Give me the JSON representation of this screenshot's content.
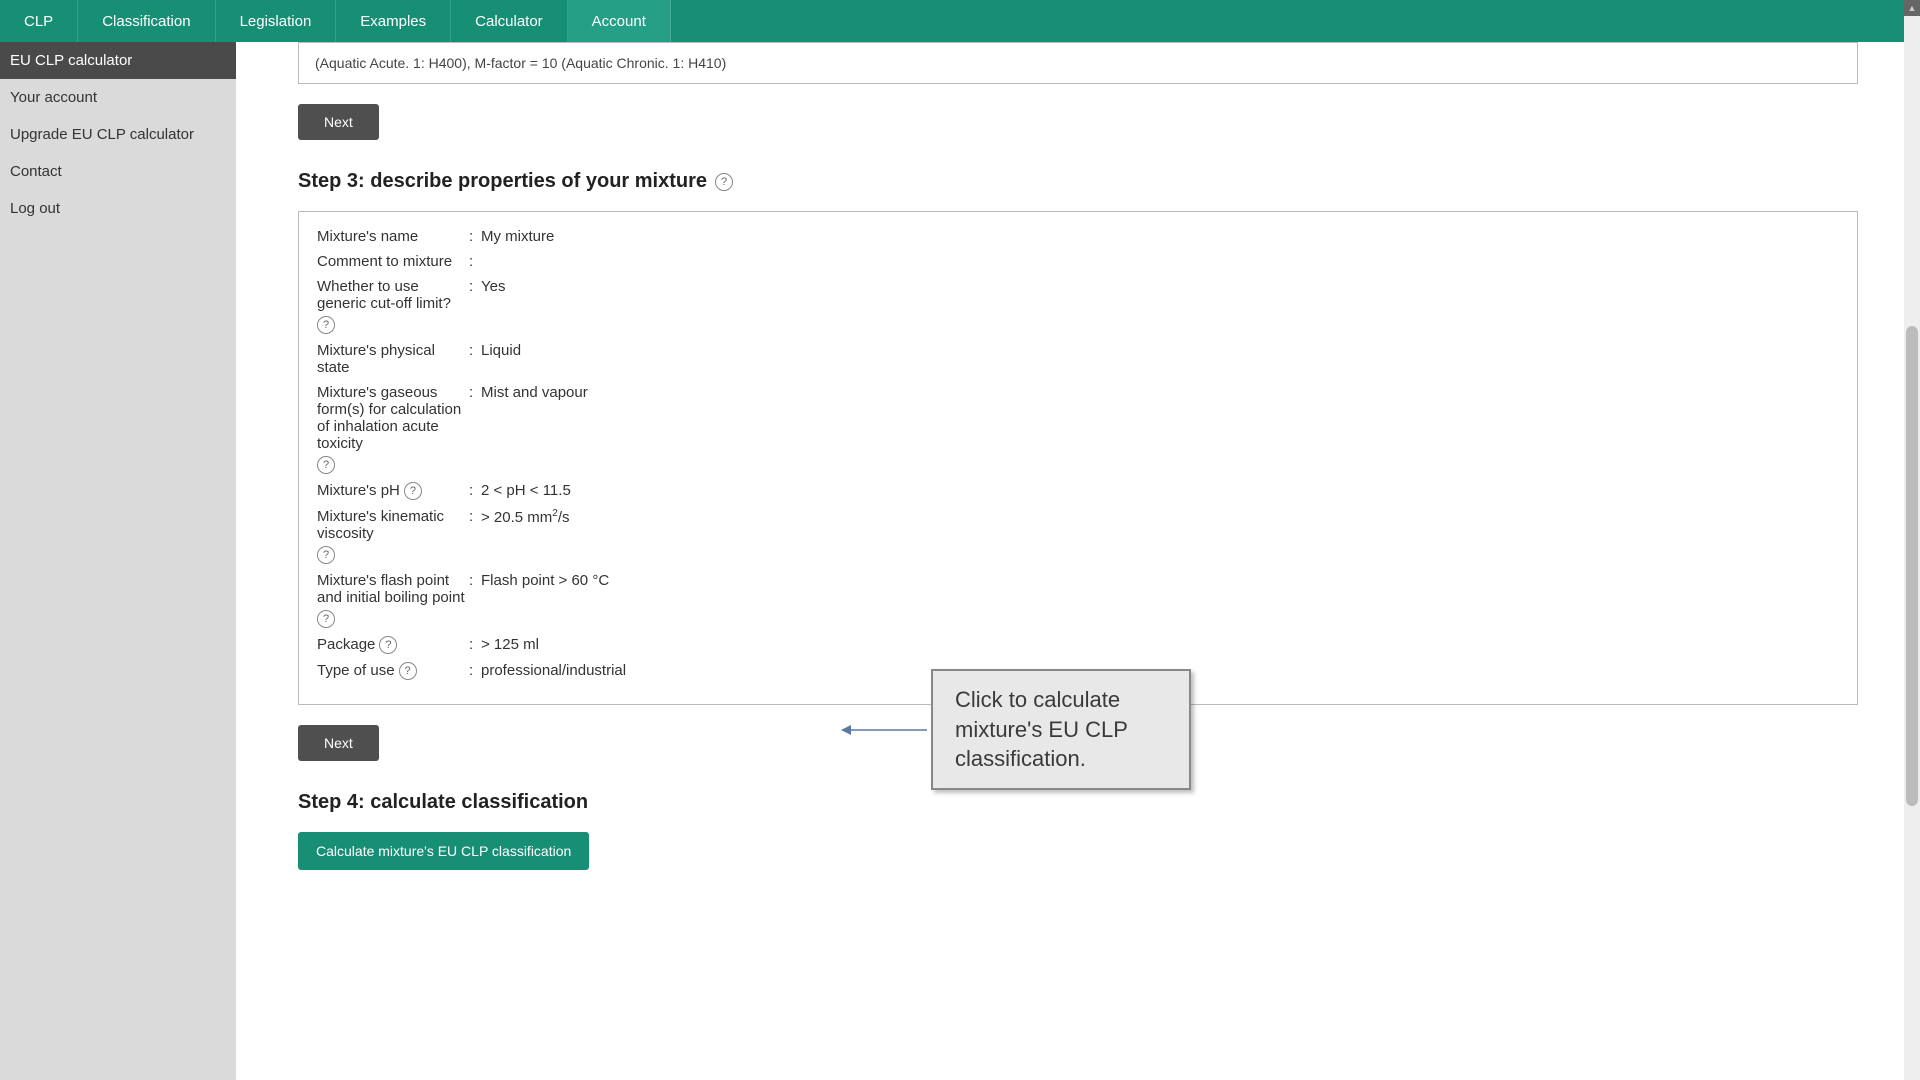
{
  "topnav": {
    "items": [
      {
        "label": "CLP"
      },
      {
        "label": "Classification"
      },
      {
        "label": "Legislation"
      },
      {
        "label": "Examples"
      },
      {
        "label": "Calculator"
      },
      {
        "label": "Account",
        "active": true
      }
    ]
  },
  "sidebar": {
    "items": [
      {
        "label": "EU CLP calculator",
        "active": true
      },
      {
        "label": "Your account"
      },
      {
        "label": "Upgrade EU CLP calculator"
      },
      {
        "label": "Contact"
      },
      {
        "label": "Log out"
      }
    ]
  },
  "step2": {
    "box_text": "(Aquatic Acute. 1: H400),  M-factor = 10 (Aquatic Chronic. 1: H410)",
    "next_label": "Next"
  },
  "step3": {
    "heading": "Step 3:  describe properties of your mixture",
    "rows": [
      {
        "label": "Mixture's name",
        "value": "My mixture",
        "help": false
      },
      {
        "label": "Comment to mixture",
        "value": "",
        "help": false
      },
      {
        "label": "Whether to use generic cut-off limit?",
        "value": "Yes",
        "help": true
      },
      {
        "label": "Mixture's physical state",
        "value": "Liquid",
        "help": false
      },
      {
        "label": "Mixture's gaseous form(s) for calculation of inhalation acute toxicity",
        "value": "Mist and vapour",
        "help": true
      },
      {
        "label": "Mixture's pH",
        "value": "2 < pH < 11.5",
        "help": true
      },
      {
        "label": "Mixture's kinematic viscosity",
        "value": "> 20.5 mm²/s",
        "help": true,
        "html": true
      },
      {
        "label": "Mixture's flash point and initial boiling point",
        "value": "Flash point > 60 °C",
        "help": true
      },
      {
        "label": "Package",
        "value": "> 125 ml",
        "help": true
      },
      {
        "label": "Type of use",
        "value": "professional/industrial",
        "help": true
      }
    ],
    "next_label": "Next"
  },
  "step4": {
    "heading": "Step 4:  calculate classification",
    "button_label": "Calculate mixture's EU CLP classification"
  },
  "callout": {
    "text": "Click to calculate mixture's EU CLP classification."
  }
}
